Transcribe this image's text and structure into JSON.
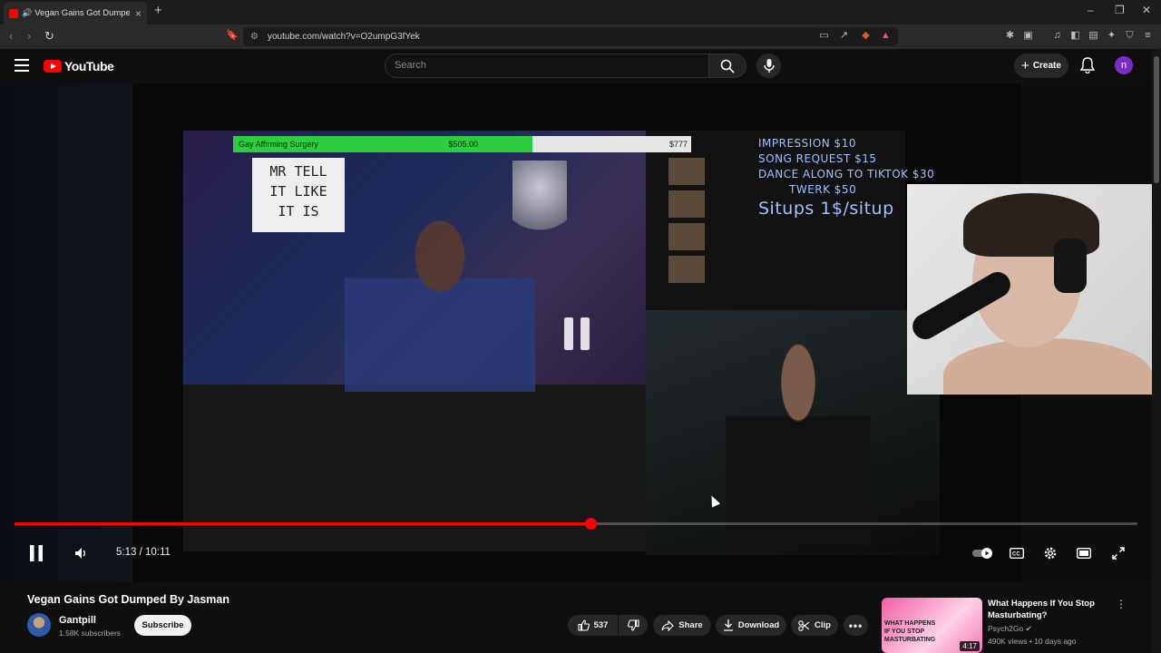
{
  "browser": {
    "tab_title": "Vegan Gains Got Dumped By",
    "new_tab": "+",
    "url": "youtube.com/watch?v=O2umpG3fYek"
  },
  "youtube": {
    "logo_text": "YouTube",
    "search_placeholder": "Search",
    "create_label": "Create",
    "avatar_letter": "n"
  },
  "video_overlay": {
    "bar_label": "Gay Affirming Surgery",
    "bar_amount": "$505.00",
    "bar_goal": "$777",
    "sign_text": [
      "MR TELL",
      "IT LIKE",
      "IT IS"
    ],
    "price_lines": [
      "IMPRESSION $10",
      "SONG REQUEST $15",
      "DANCE ALONG TO TIKTOK $30",
      "TWERK $50"
    ],
    "price_big": "Situps 1$/situp"
  },
  "player": {
    "current_time": "5:13",
    "duration": "10:11",
    "progress_fraction": 0.513
  },
  "video": {
    "title": "Vegan Gains Got Dumped By Jasman",
    "channel": "Gantpill",
    "subscribers": "1.58K subscribers",
    "subscribe_label": "Subscribe",
    "likes": "537",
    "share_label": "Share",
    "download_label": "Download",
    "clip_label": "Clip"
  },
  "recommended": {
    "title": "What Happens If You Stop Masturbating?",
    "channel": "Psych2Go",
    "views": "490K views",
    "age": "10 days ago",
    "duration": "4:17",
    "thumb_text": "WHAT HAPPENS IF YOU STOP MASTURBATING"
  }
}
